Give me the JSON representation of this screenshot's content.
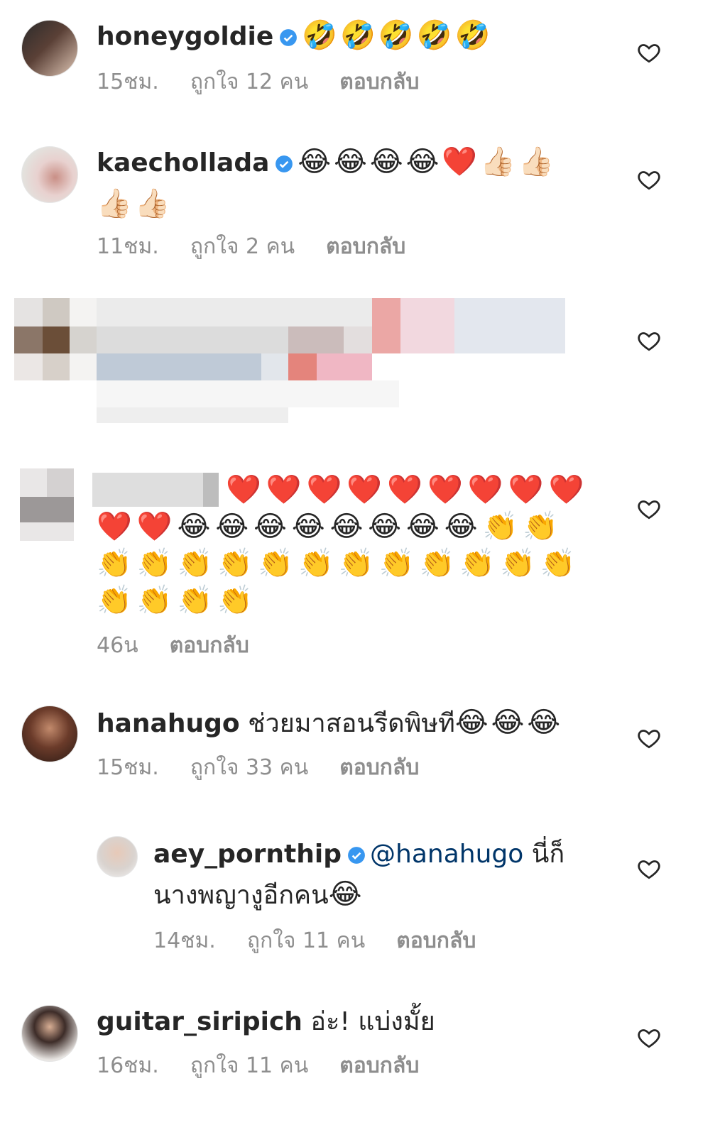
{
  "comments": [
    {
      "username": "honeygoldie",
      "verified": true,
      "text": "",
      "emoji": "🤣🤣🤣🤣🤣",
      "time": "15ชม.",
      "likes": "ถูกใจ 12 คน",
      "reply": "ตอบกลับ"
    },
    {
      "username": "kaechollada",
      "verified": true,
      "text": "",
      "emoji": "😂😂😂😂❤️👍🏻👍🏻👍🏻👍🏻",
      "time": "11ชม.",
      "likes": "ถูกใจ 2 คน",
      "reply": "ตอบกลับ"
    },
    {
      "username": "",
      "emoji": "❤️❤️❤️❤️❤️❤️❤️❤️❤️❤️❤️😂😂😂😂😂😂😂😂👏👏👏👏👏👏👏👏👏👏👏👏👏👏👏👏👏👏",
      "time": "46น",
      "reply": "ตอบกลับ"
    },
    {
      "username": "hanahugo",
      "verified": false,
      "text": "ช่วยมาสอนรีดพิษที",
      "emoji": "😂😂😂",
      "time": "15ชม.",
      "likes": "ถูกใจ 33 คน",
      "reply": "ตอบกลับ"
    },
    {
      "username": "aey_pornthip",
      "verified": true,
      "mention": "@hanahugo",
      "text": "นี่ก็",
      "text2": "นางพญางูอีกคน",
      "emoji": "😂",
      "time": "14ชม.",
      "likes": "ถูกใจ 11 คน",
      "reply": "ตอบกลับ"
    },
    {
      "username": "guitar_siripich",
      "verified": false,
      "text": "อ่ะ! แบ่งมั้ย",
      "time": "16ชม.",
      "likes": "ถูกใจ 11 คน",
      "reply": "ตอบกลับ"
    }
  ],
  "colors": {
    "verified": "#3897f0",
    "meta": "#8e8e8e",
    "mention": "#003569"
  },
  "icons": {
    "like": "heart-outline-icon",
    "verified": "verified-badge-icon"
  }
}
